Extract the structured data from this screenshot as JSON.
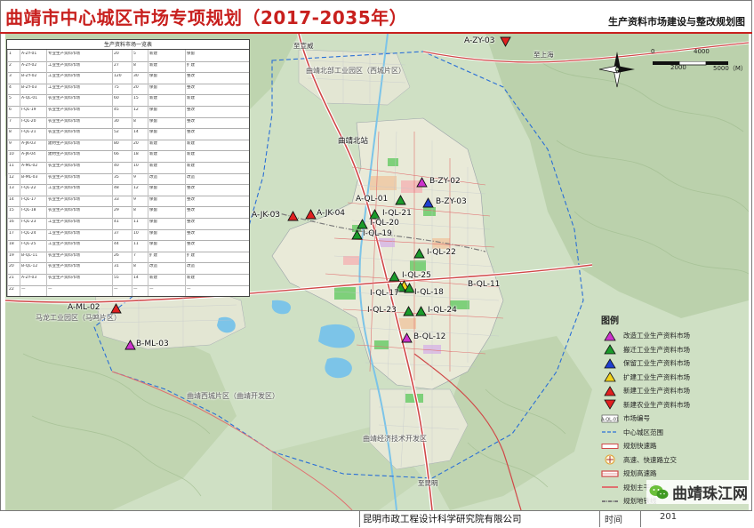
{
  "header": {
    "title": "曲靖市中心城区市场专项规划（2017-2035年）",
    "subtitle": "生产资料市场建设与整改规划图"
  },
  "footer": {
    "organization": "昆明市政工程设计科学研究院有限公司",
    "time_label": "时间",
    "date_fragment": "201"
  },
  "scale": {
    "ticks": [
      "0",
      "2000",
      "4000",
      "5000（M）"
    ]
  },
  "place_labels": {
    "north_station": "曲靖北站",
    "zone_north": "曲靖北部工业园区（西城片区）",
    "zone_west": "马龙工业园区（马鸣片区）",
    "zone_south": "曲靖西城片区（曲靖开发区）",
    "zone_se": "曲靖经济技术开发区",
    "road_east": "至上海",
    "road_south": "至昆明",
    "road_north": "至宣威"
  },
  "table": {
    "title": "生产资料市场一览表",
    "rows": [
      [
        "1",
        "A-ZY-01",
        "专业生产资料市场",
        "20",
        "5",
        "新建",
        "保留"
      ],
      [
        "2",
        "A-ZY-02",
        "工业生产资料市场",
        "27",
        "8",
        "新建",
        "扩建"
      ],
      [
        "3",
        "B-ZY-02",
        "工业生产资料市场",
        "120",
        "30",
        "保留",
        "整改"
      ],
      [
        "4",
        "B-ZY-03",
        "工业生产资料市场",
        "75",
        "20",
        "保留",
        "整改"
      ],
      [
        "5",
        "A-QL-01",
        "农业生产资料市场",
        "60",
        "15",
        "新建",
        "新建"
      ],
      [
        "6",
        "I-QL-19",
        "农业生产资料市场",
        "45",
        "12",
        "保留",
        "整改"
      ],
      [
        "7",
        "I-QL-20",
        "农业生产资料市场",
        "30",
        "8",
        "保留",
        "整改"
      ],
      [
        "8",
        "I-QL-21",
        "农业生产资料市场",
        "52",
        "14",
        "保留",
        "整改"
      ],
      [
        "9",
        "A-JK-03",
        "建材生产资料市场",
        "80",
        "20",
        "新建",
        "新建"
      ],
      [
        "10",
        "A-JK-04",
        "建材生产资料市场",
        "66",
        "18",
        "新建",
        "新建"
      ],
      [
        "11",
        "A-ML-02",
        "农业生产资料市场",
        "40",
        "10",
        "新建",
        "新建"
      ],
      [
        "12",
        "B-ML-03",
        "农业生产资料市场",
        "35",
        "9",
        "改造",
        "改造"
      ],
      [
        "13",
        "I-QL-22",
        "工业生产资料市场",
        "48",
        "12",
        "保留",
        "整改"
      ],
      [
        "14",
        "I-QL-17",
        "农业生产资料市场",
        "33",
        "9",
        "保留",
        "整改"
      ],
      [
        "15",
        "I-QL-18",
        "农业生产资料市场",
        "29",
        "8",
        "保留",
        "整改"
      ],
      [
        "16",
        "I-QL-23",
        "工业生产资料市场",
        "41",
        "11",
        "保留",
        "整改"
      ],
      [
        "17",
        "I-QL-24",
        "工业生产资料市场",
        "37",
        "10",
        "保留",
        "整改"
      ],
      [
        "18",
        "I-QL-25",
        "工业生产资料市场",
        "44",
        "11",
        "保留",
        "整改"
      ],
      [
        "19",
        "B-QL-11",
        "农业生产资料市场",
        "26",
        "7",
        "扩建",
        "扩建"
      ],
      [
        "20",
        "B-QL-12",
        "农业生产资料市场",
        "31",
        "8",
        "改造",
        "改造"
      ],
      [
        "21",
        "A-ZY-03",
        "农业生产资料市场",
        "55",
        "14",
        "新建",
        "新建"
      ],
      [
        "22",
        "—",
        "—",
        "—",
        "—",
        "—",
        "—"
      ]
    ]
  },
  "markers": [
    {
      "id": "A-ZY-03",
      "type": "new-agri",
      "color": "#e02020"
    },
    {
      "id": "B-ZY-02",
      "type": "renovate",
      "color": "#cc33cc"
    },
    {
      "id": "A-QL-01",
      "type": "relocate",
      "color": "#1a9a2a"
    },
    {
      "id": "B-ZY-03",
      "type": "retain",
      "color": "#1f3fd0"
    },
    {
      "id": "A-JK-03",
      "type": "new-industrial",
      "color": "#e02020"
    },
    {
      "id": "A-JK-04",
      "type": "new-industrial",
      "color": "#e02020"
    },
    {
      "id": "I-QL-21",
      "type": "relocate",
      "color": "#1a9a2a"
    },
    {
      "id": "I-QL-20",
      "type": "relocate",
      "color": "#1a9a2a"
    },
    {
      "id": "I-QL-19",
      "type": "relocate",
      "color": "#1a9a2a"
    },
    {
      "id": "I-QL-22",
      "type": "relocate",
      "color": "#1a9a2a"
    },
    {
      "id": "I-QL-25",
      "type": "relocate",
      "color": "#1a9a2a"
    },
    {
      "id": "B-QL-11",
      "type": "expand",
      "color": "#f2d21b"
    },
    {
      "id": "I-QL-17",
      "type": "relocate",
      "color": "#1a9a2a"
    },
    {
      "id": "I-QL-18",
      "type": "relocate",
      "color": "#1a9a2a"
    },
    {
      "id": "I-QL-23",
      "type": "relocate",
      "color": "#1a9a2a"
    },
    {
      "id": "I-QL-24",
      "type": "relocate",
      "color": "#1a9a2a"
    },
    {
      "id": "B-QL-12",
      "type": "renovate",
      "color": "#cc33cc"
    },
    {
      "id": "A-ML-02",
      "type": "new-industrial",
      "color": "#e02020"
    },
    {
      "id": "B-ML-03",
      "type": "renovate",
      "color": "#cc33cc"
    }
  ],
  "legend": {
    "title": "图例",
    "items": [
      {
        "label": "改造工业生产资料市场",
        "symbol": "tri-up",
        "color": "#cc33cc"
      },
      {
        "label": "搬迁工业生产资料市场",
        "symbol": "tri-up",
        "color": "#1a9a2a"
      },
      {
        "label": "保留工业生产资料市场",
        "symbol": "tri-up",
        "color": "#1f3fd0"
      },
      {
        "label": "扩建工业生产资料市场",
        "symbol": "tri-up",
        "color": "#f2d21b"
      },
      {
        "label": "新建工业生产资料市场",
        "symbol": "tri-up",
        "color": "#e02020"
      },
      {
        "label": "新建农业生产资料市场",
        "symbol": "tri-down",
        "color": "#e02020"
      },
      {
        "label": "市场编号",
        "symbol": "code-box",
        "color": "#444444"
      },
      {
        "label": "中心城区范围",
        "symbol": "boundary-line",
        "color": "#2a6fd6"
      },
      {
        "label": "规划快速路",
        "symbol": "road-express",
        "color": "#d04848"
      },
      {
        "label": "高速、快速路立交",
        "symbol": "interchange",
        "color": "#e0a030"
      },
      {
        "label": "规划高速路",
        "symbol": "road-highway",
        "color": "#d04848"
      },
      {
        "label": "规划主干道",
        "symbol": "road-arterial",
        "color": "#e07070"
      },
      {
        "label": "规划地铁线",
        "symbol": "road-rail",
        "color": "#7a7a7a"
      }
    ]
  },
  "badge": {
    "text": "曲靖珠江网",
    "icon": "wechat-bubble-icon"
  }
}
